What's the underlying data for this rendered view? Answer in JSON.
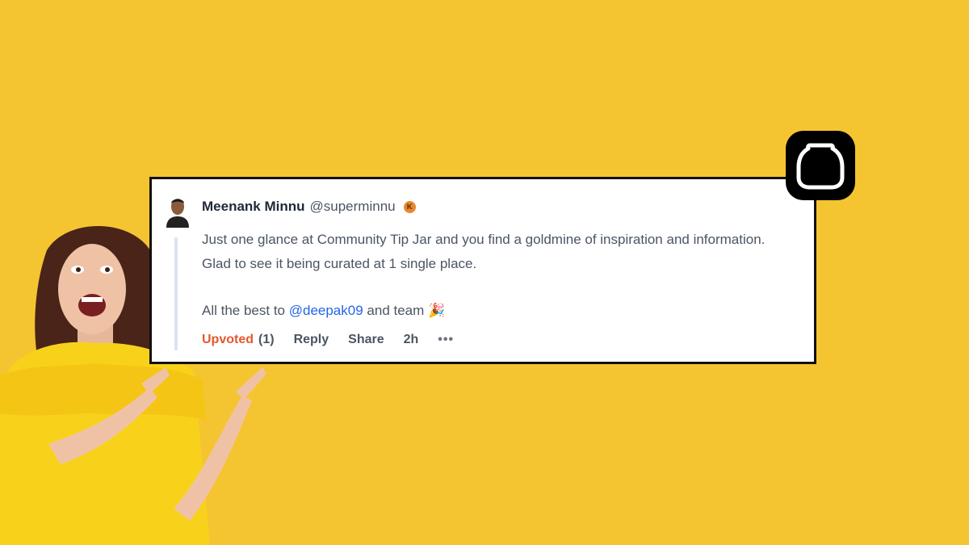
{
  "comment": {
    "author_name": "Meenank Minnu",
    "author_handle": "@superminnu",
    "karma_badge": "K",
    "line1": "Just one glance at Community Tip Jar and you find a goldmine of inspiration and information.",
    "line2": "Glad to see it being curated at 1 single place.",
    "line3_prefix": "All the best to ",
    "mention": "@deepak09",
    "line3_suffix": " and team 🎉",
    "actions": {
      "upvoted_label": "Upvoted",
      "upvote_count": "(1)",
      "reply_label": "Reply",
      "share_label": "Share",
      "time_ago": "2h",
      "more_label": "•••"
    }
  },
  "icons": {
    "logo": "jar-logo-icon",
    "more": "more-options-icon",
    "avatar": "user-avatar"
  },
  "colors": {
    "background": "#F5C431",
    "upvoted": "#E4572E",
    "mention": "#2563EB",
    "karma_badge": "#E8872F"
  }
}
